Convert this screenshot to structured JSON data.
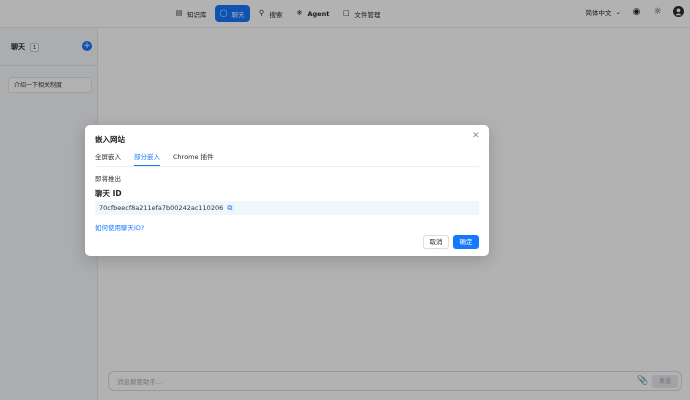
{
  "nav": {
    "items": [
      {
        "label": "知识库",
        "icon": "database-icon"
      },
      {
        "label": "聊天",
        "icon": "chat-icon",
        "active": true
      },
      {
        "label": "搜索",
        "icon": "search-icon"
      },
      {
        "label": "Agent",
        "icon": "agent-icon"
      },
      {
        "label": "文件管理",
        "icon": "folder-icon"
      }
    ],
    "language": "简体中文"
  },
  "sidebar": {
    "title": "聊天",
    "count": "1",
    "items": [
      {
        "label": "介绍一下相关制度"
      }
    ]
  },
  "composer": {
    "placeholder": "消息概要助手...",
    "send_label": "发送"
  },
  "dialog": {
    "title": "嵌入网站",
    "tabs": [
      {
        "label": "全屏嵌入"
      },
      {
        "label": "部分嵌入",
        "active": true
      },
      {
        "label": "Chrome 插件"
      }
    ],
    "note": "即将推出",
    "field_label": "聊天 ID",
    "chat_id": "70cfbeecf8a211efa7b00242ac110206",
    "help_link": "如何使用聊天ID?",
    "cancel_label": "取消",
    "ok_label": "确定"
  },
  "colors": {
    "accent": "#1677ff"
  }
}
